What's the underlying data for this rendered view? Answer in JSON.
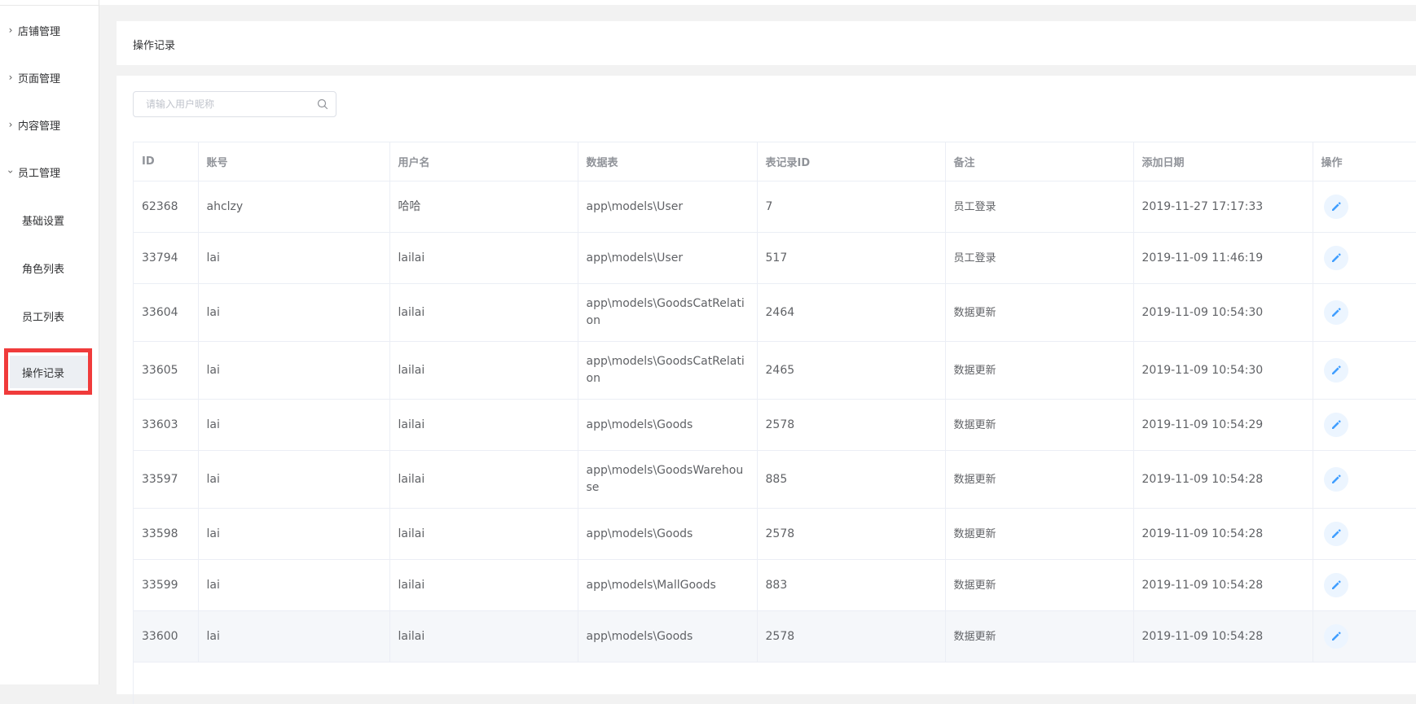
{
  "sidebar": {
    "groups": [
      {
        "label": "店铺管理"
      },
      {
        "label": "页面管理"
      },
      {
        "label": "内容管理"
      },
      {
        "label": "员工管理"
      }
    ],
    "staff_items": [
      {
        "label": "基础设置"
      },
      {
        "label": "角色列表"
      },
      {
        "label": "员工列表"
      },
      {
        "label": "操作记录"
      }
    ]
  },
  "page": {
    "title": "操作记录"
  },
  "search": {
    "placeholder": "请输入用户昵称",
    "value": ""
  },
  "table": {
    "columns": [
      "ID",
      "账号",
      "用户名",
      "数据表",
      "表记录ID",
      "备注",
      "添加日期",
      "操作"
    ],
    "rows": [
      [
        "62368",
        "ahclzy",
        "哈哈",
        "app\\models\\User",
        "7",
        "员工登录",
        "2019-11-27 17:17:33"
      ],
      [
        "33794",
        "lai",
        "lailai",
        "app\\models\\User",
        "517",
        "员工登录",
        "2019-11-09 11:46:19"
      ],
      [
        "33604",
        "lai",
        "lailai",
        "app\\models\\GoodsCatRelation",
        "2464",
        "数据更新",
        "2019-11-09 10:54:30"
      ],
      [
        "33605",
        "lai",
        "lailai",
        "app\\models\\GoodsCatRelation",
        "2465",
        "数据更新",
        "2019-11-09 10:54:30"
      ],
      [
        "33603",
        "lai",
        "lailai",
        "app\\models\\Goods",
        "2578",
        "数据更新",
        "2019-11-09 10:54:29"
      ],
      [
        "33597",
        "lai",
        "lailai",
        "app\\models\\GoodsWarehouse",
        "885",
        "数据更新",
        "2019-11-09 10:54:28"
      ],
      [
        "33598",
        "lai",
        "lailai",
        "app\\models\\Goods",
        "2578",
        "数据更新",
        "2019-11-09 10:54:28"
      ],
      [
        "33599",
        "lai",
        "lailai",
        "app\\models\\MallGoods",
        "883",
        "数据更新",
        "2019-11-09 10:54:28"
      ],
      [
        "33600",
        "lai",
        "lailai",
        "app\\models\\Goods",
        "2578",
        "数据更新",
        "2019-11-09 10:54:28"
      ]
    ]
  },
  "icons": {
    "chevron_closed": "chevron-right-icon",
    "chevron_open": "chevron-down-icon",
    "search": "search-icon",
    "edit": "edit-pencil-icon"
  },
  "colors": {
    "accent": "#409eff",
    "highlight": "#f03b3b",
    "active_item_bg": "#eceff3",
    "hover_row_bg": "#f5f7fa"
  }
}
